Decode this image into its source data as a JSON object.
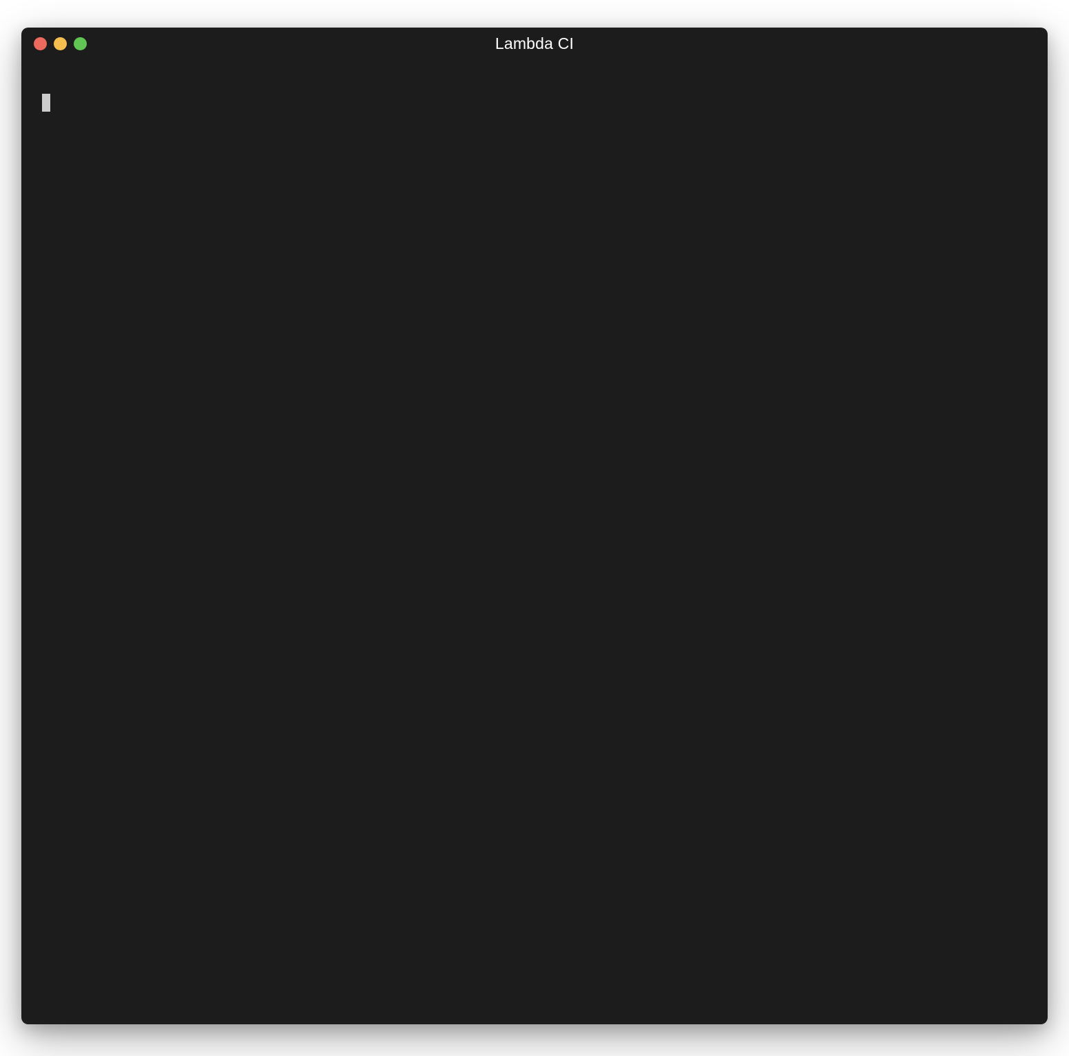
{
  "window": {
    "title": "Lambda CI"
  },
  "traffic_lights": {
    "close_color": "#ed6a5e",
    "minimize_color": "#f4bf4f",
    "zoom_color": "#61c554"
  },
  "terminal": {
    "current_input": ""
  }
}
